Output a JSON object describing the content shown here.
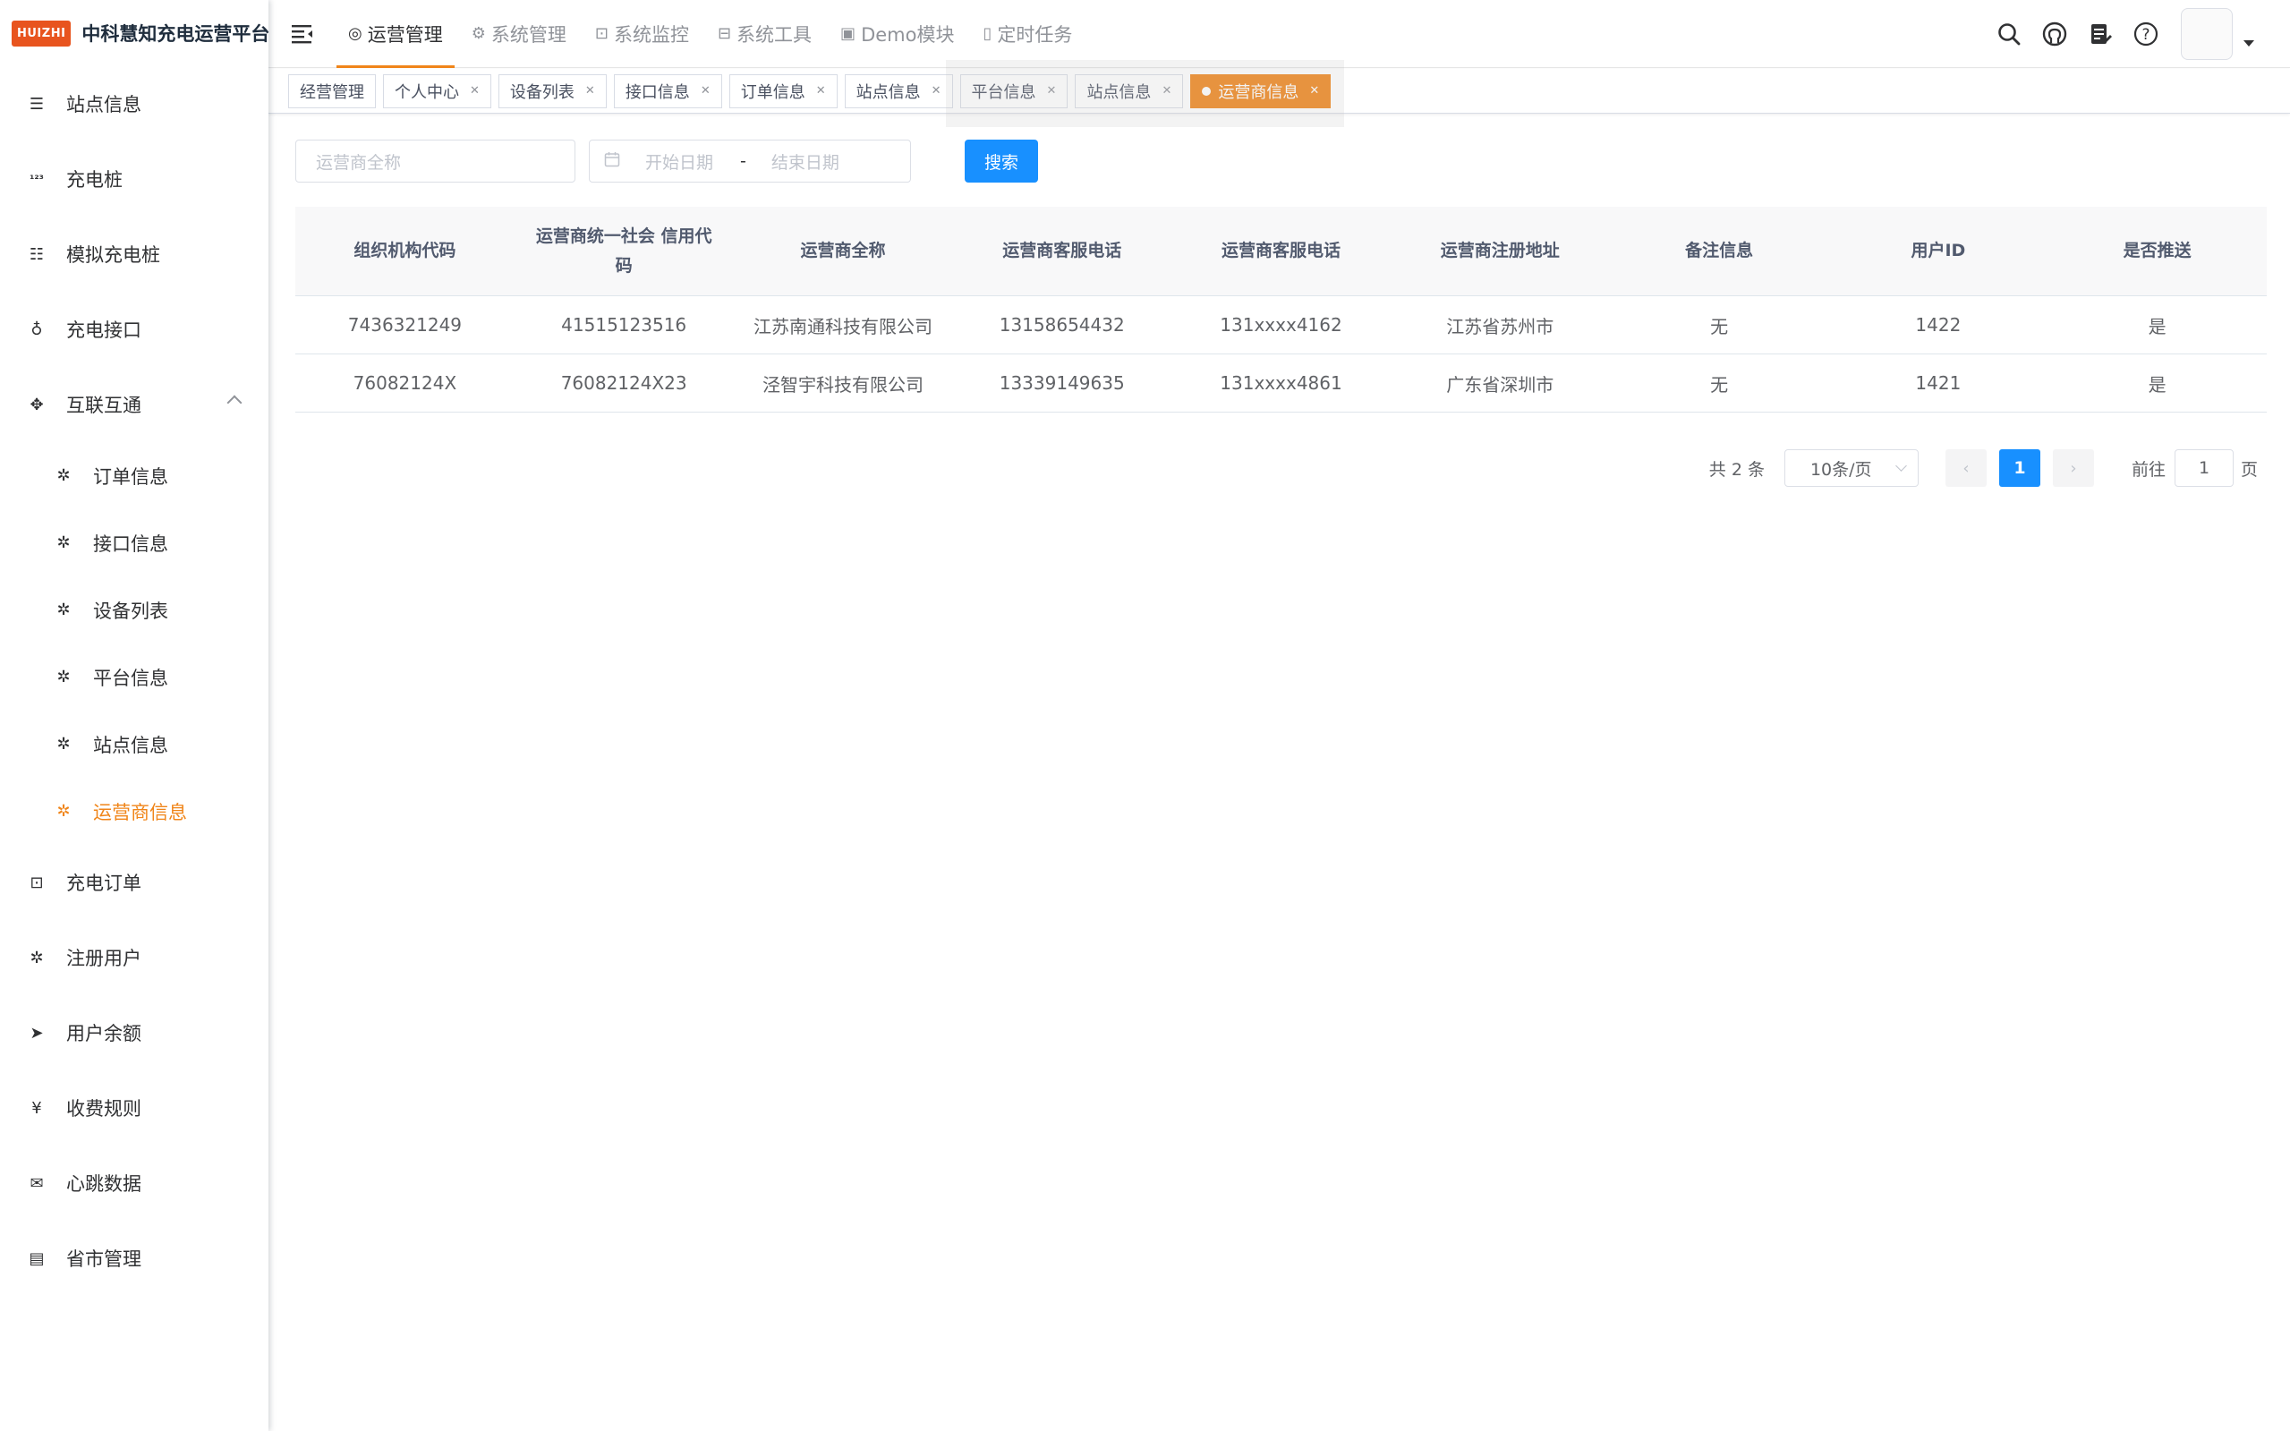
{
  "app": {
    "logo_badge": "HUIZHI",
    "title": "中科慧知充电运营平台"
  },
  "sidebar": {
    "items": [
      {
        "label": "站点信息",
        "icon": "list-icon"
      },
      {
        "label": "充电桩",
        "icon": "number-icon"
      },
      {
        "label": "模拟充电桩",
        "icon": "list-check-icon"
      },
      {
        "label": "充电接口",
        "icon": "plug-icon"
      },
      {
        "label": "互联互通",
        "icon": "puzzle-icon",
        "expanded": true
      },
      {
        "label": "充电订单",
        "icon": "monitor-icon"
      },
      {
        "label": "注册用户",
        "icon": "bug-icon"
      },
      {
        "label": "用户余额",
        "icon": "send-icon"
      },
      {
        "label": "收费规则",
        "icon": "yen-icon"
      },
      {
        "label": "心跳数据",
        "icon": "email-icon"
      },
      {
        "label": "省市管理",
        "icon": "server-icon"
      }
    ],
    "subitems": [
      {
        "label": "订单信息",
        "icon": "bug-icon"
      },
      {
        "label": "接口信息",
        "icon": "bug-icon"
      },
      {
        "label": "设备列表",
        "icon": "bug-icon"
      },
      {
        "label": "平台信息",
        "icon": "bug-icon"
      },
      {
        "label": "站点信息",
        "icon": "bug-icon"
      },
      {
        "label": "运营商信息",
        "icon": "bug-icon",
        "active": true
      }
    ]
  },
  "topnav": {
    "items": [
      {
        "label": "运营管理",
        "active": true
      },
      {
        "label": "系统管理"
      },
      {
        "label": "系统监控"
      },
      {
        "label": "系统工具"
      },
      {
        "label": "Demo模块"
      },
      {
        "label": "定时任务"
      }
    ]
  },
  "tags": [
    {
      "label": "经营管理",
      "closable": false
    },
    {
      "label": "个人中心",
      "closable": true
    },
    {
      "label": "设备列表",
      "closable": true
    },
    {
      "label": "接口信息",
      "closable": true
    },
    {
      "label": "订单信息",
      "closable": true
    },
    {
      "label": "站点信息",
      "closable": true
    },
    {
      "label": "平台信息",
      "closable": true
    },
    {
      "label": "站点信息",
      "closable": true
    },
    {
      "label": "运营商信息",
      "closable": true,
      "active": true
    }
  ],
  "search": {
    "name_placeholder": "运营商全称",
    "start_placeholder": "开始日期",
    "separator": "-",
    "end_placeholder": "结束日期",
    "button": "搜索"
  },
  "table": {
    "headers": [
      "组织机构代码",
      "运营商统一社会 信用代码",
      "运营商全称",
      "运营商客服电话",
      "运营商客服电话",
      "运营商注册地址",
      "备注信息",
      "用户ID",
      "是否推送"
    ],
    "rows": [
      [
        "7436321249",
        "41515123516",
        "江苏南通科技有限公司",
        "13158654432",
        "131xxxx4162",
        "江苏省苏州市",
        "无",
        "1422",
        "是"
      ],
      [
        "76082124X",
        "76082124X23",
        "泾智宇科技有限公司",
        "13339149635",
        "131xxxx4861",
        "广东省深圳市",
        "无",
        "1421",
        "是"
      ]
    ]
  },
  "pagination": {
    "total": "共 2 条",
    "page_size": "10条/页",
    "current_page": "1",
    "goto_label": "前往",
    "goto_value": "1",
    "page_unit": "页"
  },
  "colors": {
    "accent": "#f08519",
    "primary": "#1890ff",
    "logo": "#e8541e"
  }
}
